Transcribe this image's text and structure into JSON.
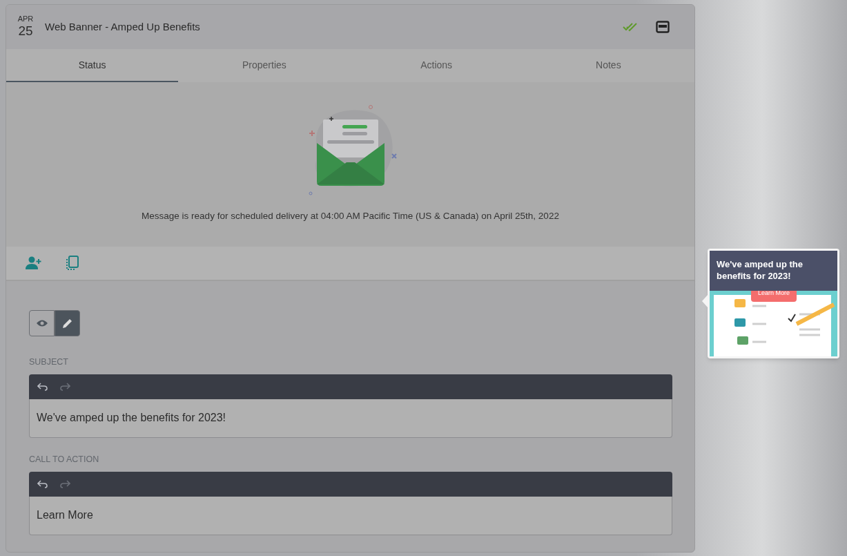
{
  "header": {
    "month": "APR",
    "day": "25",
    "title": "Web Banner - Amped Up Benefits"
  },
  "tabs": [
    {
      "label": "Status",
      "selected": true
    },
    {
      "label": "Properties",
      "selected": false
    },
    {
      "label": "Actions",
      "selected": false
    },
    {
      "label": "Notes",
      "selected": false
    }
  ],
  "status": {
    "message": "Message is ready for scheduled delivery at 04:00 AM Pacific Time (US & Canada) on April 25th, 2022"
  },
  "mode_toggle": [
    {
      "kind": "view",
      "selected": false
    },
    {
      "kind": "edit",
      "selected": true
    }
  ],
  "fields": [
    {
      "label": "SUBJECT",
      "value": "We've amped up the benefits for 2023!"
    },
    {
      "label": "CALL TO ACTION",
      "value": "Learn More"
    }
  ],
  "preview": {
    "headline": "We've amped up the benefits for 2023!",
    "button": "Learn More"
  }
}
